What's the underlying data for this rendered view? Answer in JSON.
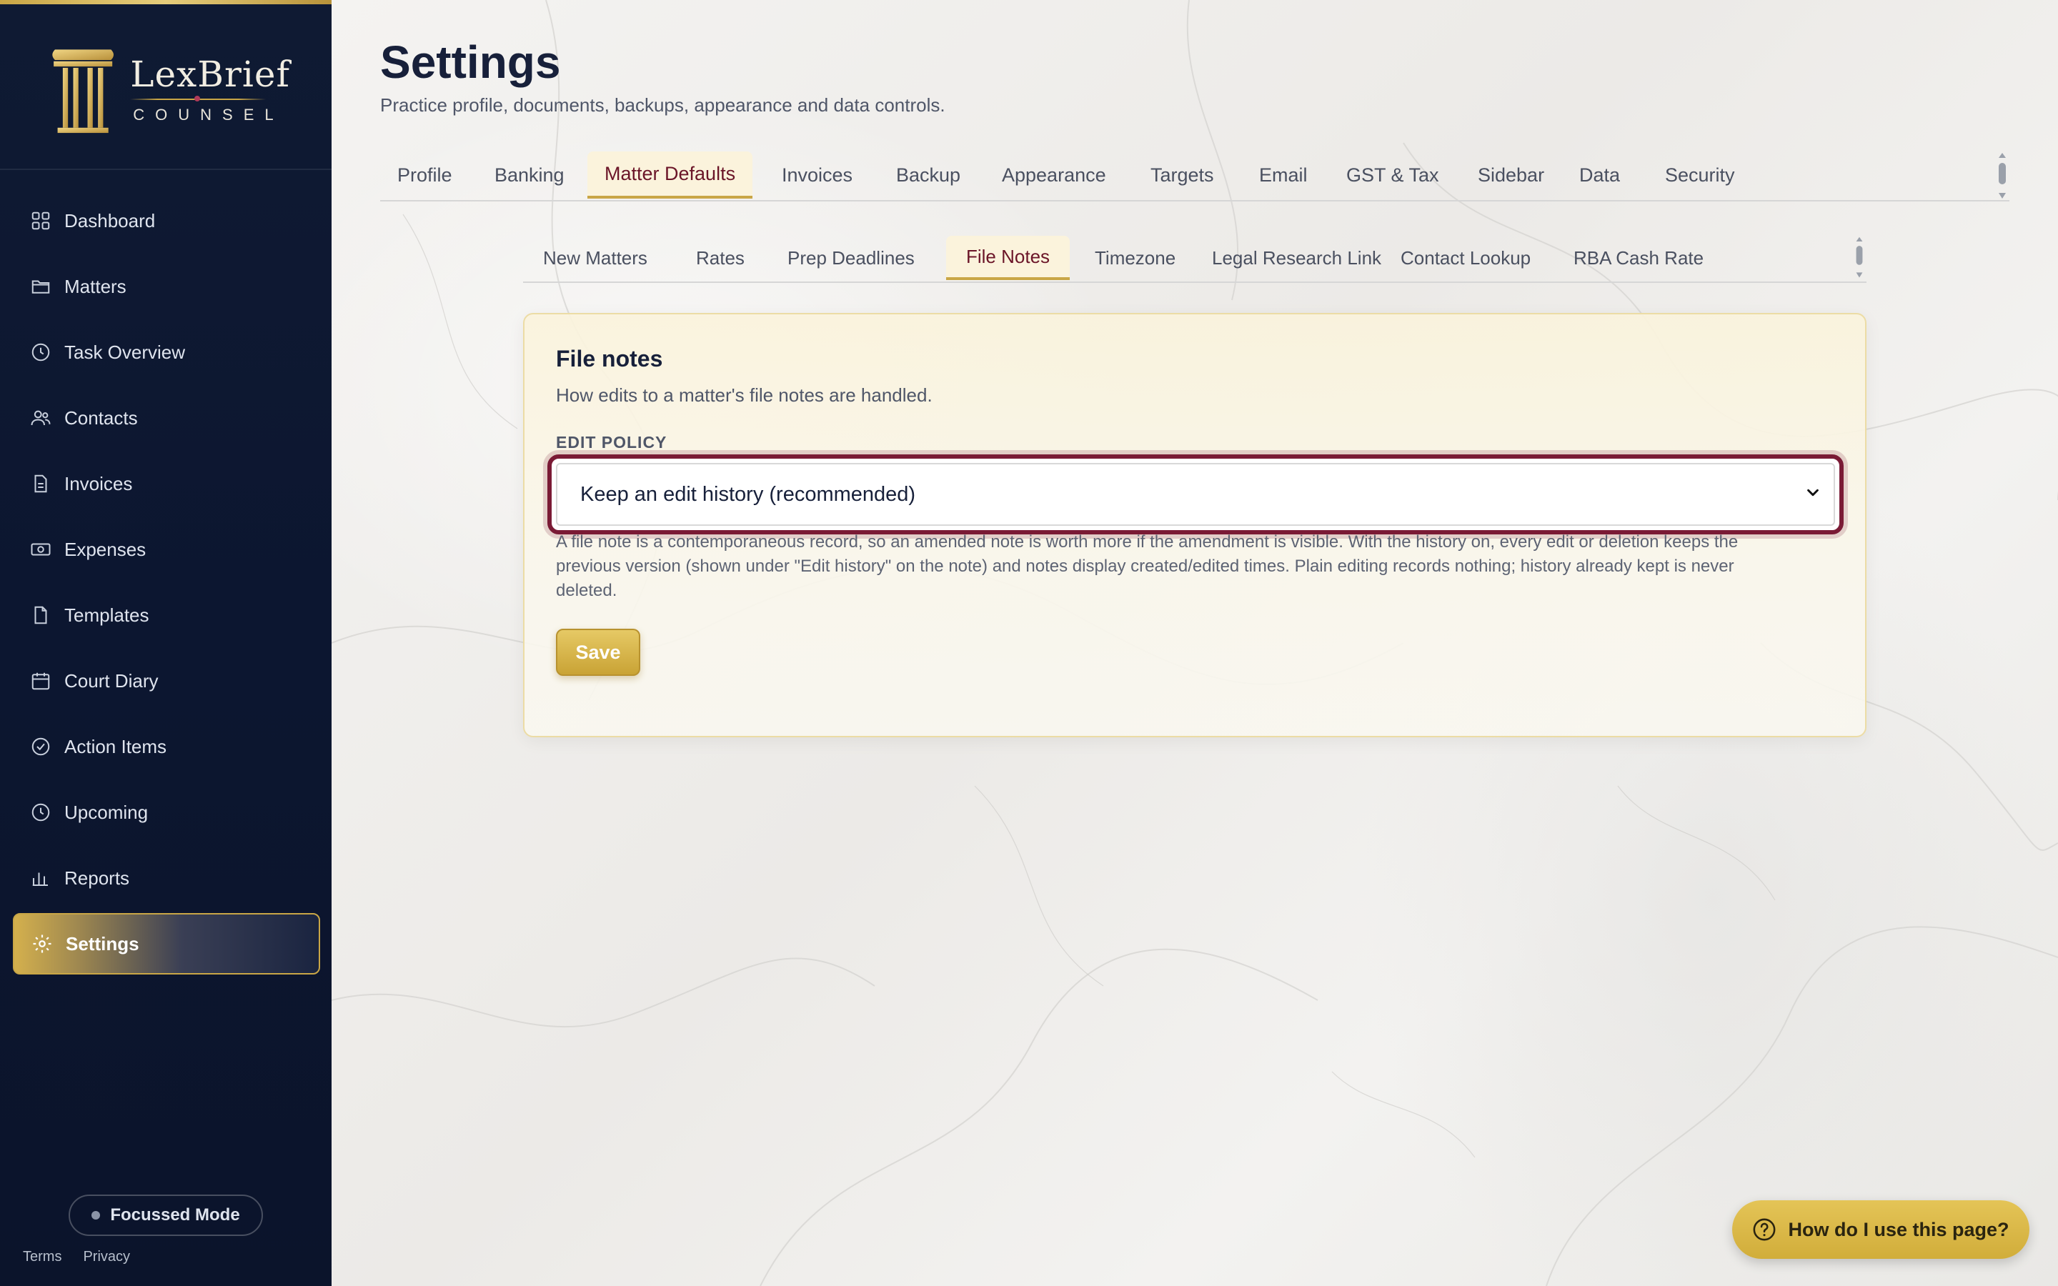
{
  "brand": {
    "name": "LexBrief",
    "subtitle": "COUNSEL"
  },
  "sidebar": {
    "items": [
      {
        "label": "Dashboard",
        "icon": "dashboard-icon"
      },
      {
        "label": "Matters",
        "icon": "folder-icon"
      },
      {
        "label": "Task Overview",
        "icon": "clock-icon"
      },
      {
        "label": "Contacts",
        "icon": "users-icon"
      },
      {
        "label": "Invoices",
        "icon": "document-icon"
      },
      {
        "label": "Expenses",
        "icon": "money-icon"
      },
      {
        "label": "Templates",
        "icon": "file-icon"
      },
      {
        "label": "Court Diary",
        "icon": "calendar-icon"
      },
      {
        "label": "Action Items",
        "icon": "check-circle-icon"
      },
      {
        "label": "Upcoming",
        "icon": "clock-icon"
      },
      {
        "label": "Reports",
        "icon": "bar-chart-icon"
      },
      {
        "label": "Settings",
        "icon": "gear-icon",
        "active": true
      }
    ],
    "focus_mode": "Focussed Mode",
    "footer": {
      "terms": "Terms",
      "privacy": "Privacy"
    }
  },
  "header": {
    "title": "Settings",
    "subtitle": "Practice profile, documents, backups, appearance and data controls."
  },
  "tabs": [
    "Profile",
    "Banking",
    "Matter Defaults",
    "Invoices",
    "Backup",
    "Appearance",
    "Targets",
    "Email",
    "GST & Tax",
    "Sidebar",
    "Data",
    "Security"
  ],
  "active_tab": "Matter Defaults",
  "subtabs": [
    "New Matters",
    "Rates",
    "Prep Deadlines",
    "File Notes",
    "Timezone",
    "Legal Research Link",
    "Contact Lookup",
    "RBA Cash Rate"
  ],
  "active_subtab": "File Notes",
  "card": {
    "title": "File notes",
    "description": "How edits to a matter's file notes are handled.",
    "field_label": "EDIT POLICY",
    "select_value": "Keep an edit history (recommended)",
    "help_line1": "A file note is a contemporaneous record, so an amended note is worth more if the amendment is visible. With the history on, every edit or deletion keeps the",
    "help_line2": "previous version (shown under \"Edit history\" on the note) and notes display created/edited times. Plain editing records nothing; history already kept is never",
    "help_line3": "deleted.",
    "save_label": "Save"
  },
  "help_button": "How do I use this page?",
  "colors": {
    "accent_gold": "#c9a646",
    "accent_maroon": "#7a1a35",
    "sidebar_navy": "#0f1a33"
  }
}
